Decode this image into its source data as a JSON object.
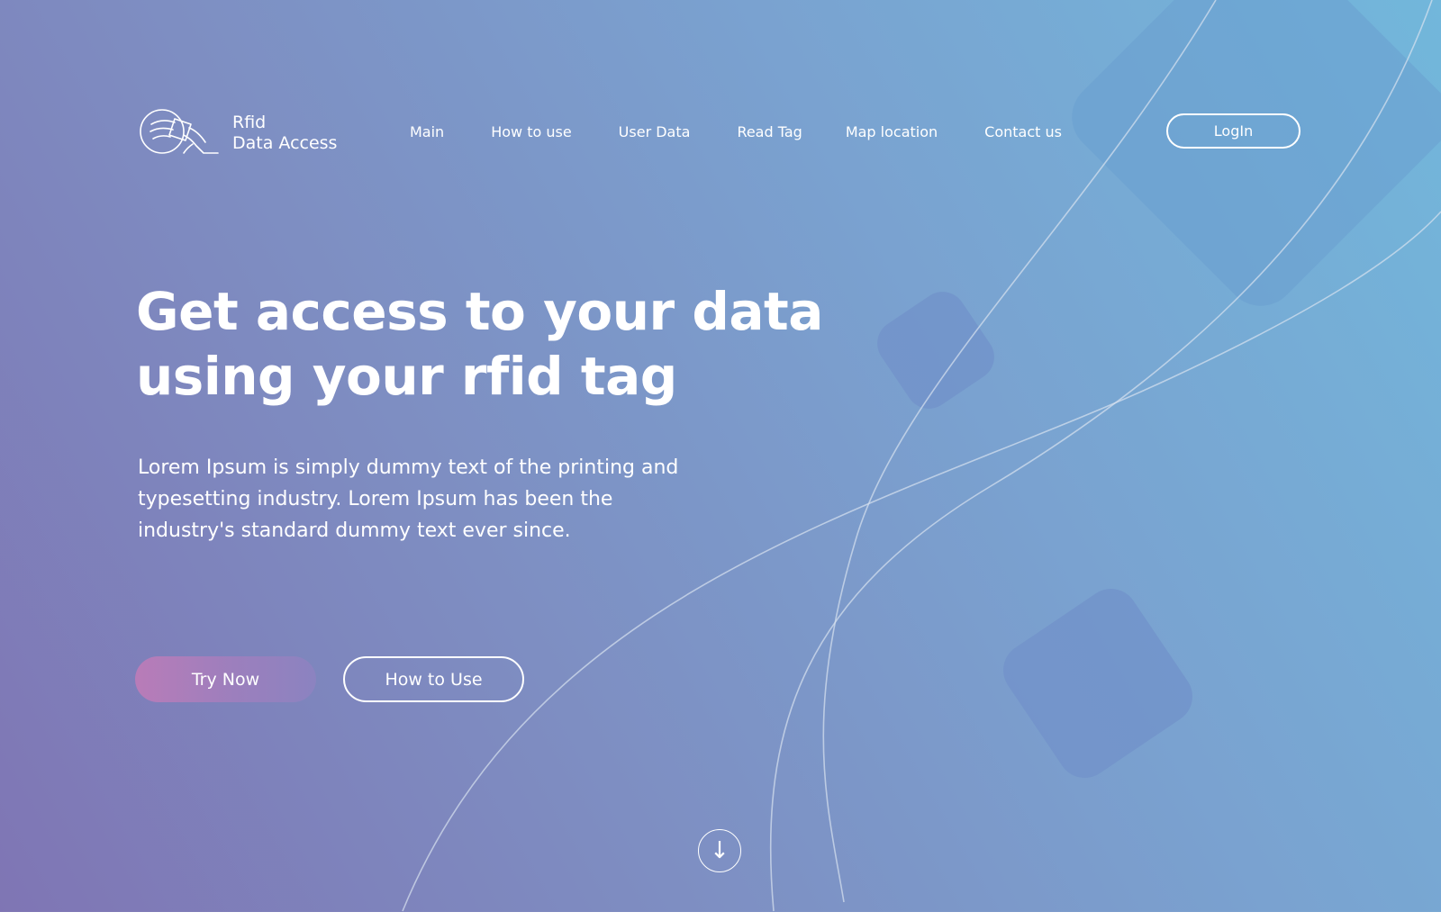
{
  "brand": {
    "logo_icon": "rfid-card-hand-icon",
    "name_line1": "Rfid",
    "name_line2": "Data Access"
  },
  "nav": {
    "items": [
      {
        "label": "Main"
      },
      {
        "label": "How to use"
      },
      {
        "label": "User Data"
      },
      {
        "label": "Read Tag"
      },
      {
        "label": "Map location"
      },
      {
        "label": "Contact us"
      }
    ],
    "login_label": "LogIn"
  },
  "hero": {
    "title_line1": "Get access to your data",
    "title_line2": "using your rfid tag",
    "desc_line1": "Lorem Ipsum is simply dummy text of the printing  and",
    "desc_line2": "typesetting industry. Lorem Ipsum has been  the",
    "desc_line3": "industry's standard dummy text ever since.",
    "primary_button": "Try Now",
    "secondary_button": "How to Use"
  },
  "scroll": {
    "icon": "arrow-down-icon",
    "glyph": "↓"
  },
  "colors": {
    "gradient_left": "#7f75b4",
    "gradient_right": "#72b7db",
    "primary_button_start": "#b97cb8",
    "primary_button_end": "#8b83c0",
    "text": "#ffffff"
  }
}
